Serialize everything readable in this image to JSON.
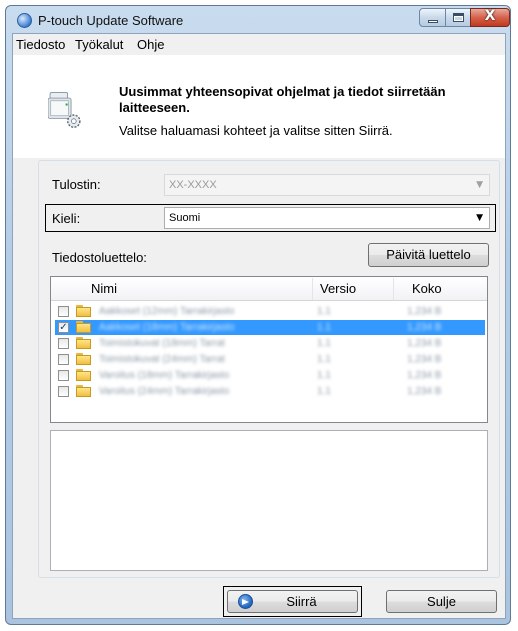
{
  "window": {
    "title": "P-touch Update Software",
    "close_glyph": "X"
  },
  "menu": [
    "Tiedosto",
    "Työkalut",
    "Ohje"
  ],
  "message": {
    "bold": "Uusimmat yhteensopivat ohjelmat ja tiedot siirretään laitteeseen.",
    "normal": "Valitse haluamasi kohteet ja valitse sitten Siirrä."
  },
  "printer": {
    "label": "Tulostin:",
    "value": "XX-XXXX"
  },
  "language": {
    "label": "Kieli:",
    "value": "Suomi"
  },
  "file_list": {
    "label": "Tiedostoluettelo:",
    "refresh_button": "Päivitä luettelo",
    "columns": [
      "Nimi",
      "Versio",
      "Koko"
    ],
    "rows": [
      {
        "checked": false,
        "selected": false,
        "name": "Aakkoset (12mm) Tarrakirjasto",
        "version": "1.1",
        "size": "1,234 B"
      },
      {
        "checked": true,
        "selected": true,
        "name": "Aakkoset (18mm) Tarrakirjasto",
        "version": "1.1",
        "size": "1,234 B"
      },
      {
        "checked": false,
        "selected": false,
        "name": "Toimistokuvat (18mm) Tarrat",
        "version": "1.1",
        "size": "1,234 B"
      },
      {
        "checked": false,
        "selected": false,
        "name": "Toimistokuvat (24mm) Tarrat",
        "version": "1.1",
        "size": "1,234 B"
      },
      {
        "checked": false,
        "selected": false,
        "name": "Varoitus (18mm) Tarrakirjasto",
        "version": "1.1",
        "size": "1,234 B"
      },
      {
        "checked": false,
        "selected": false,
        "name": "Varoitus (24mm) Tarrakirjasto",
        "version": "1.1",
        "size": "1,234 B"
      }
    ]
  },
  "buttons": {
    "transfer": "Siirrä",
    "close": "Sulje"
  },
  "colors": {
    "selection": "#3399ff",
    "title_bar": "#b4cde6",
    "close_button": "#c2391f"
  }
}
